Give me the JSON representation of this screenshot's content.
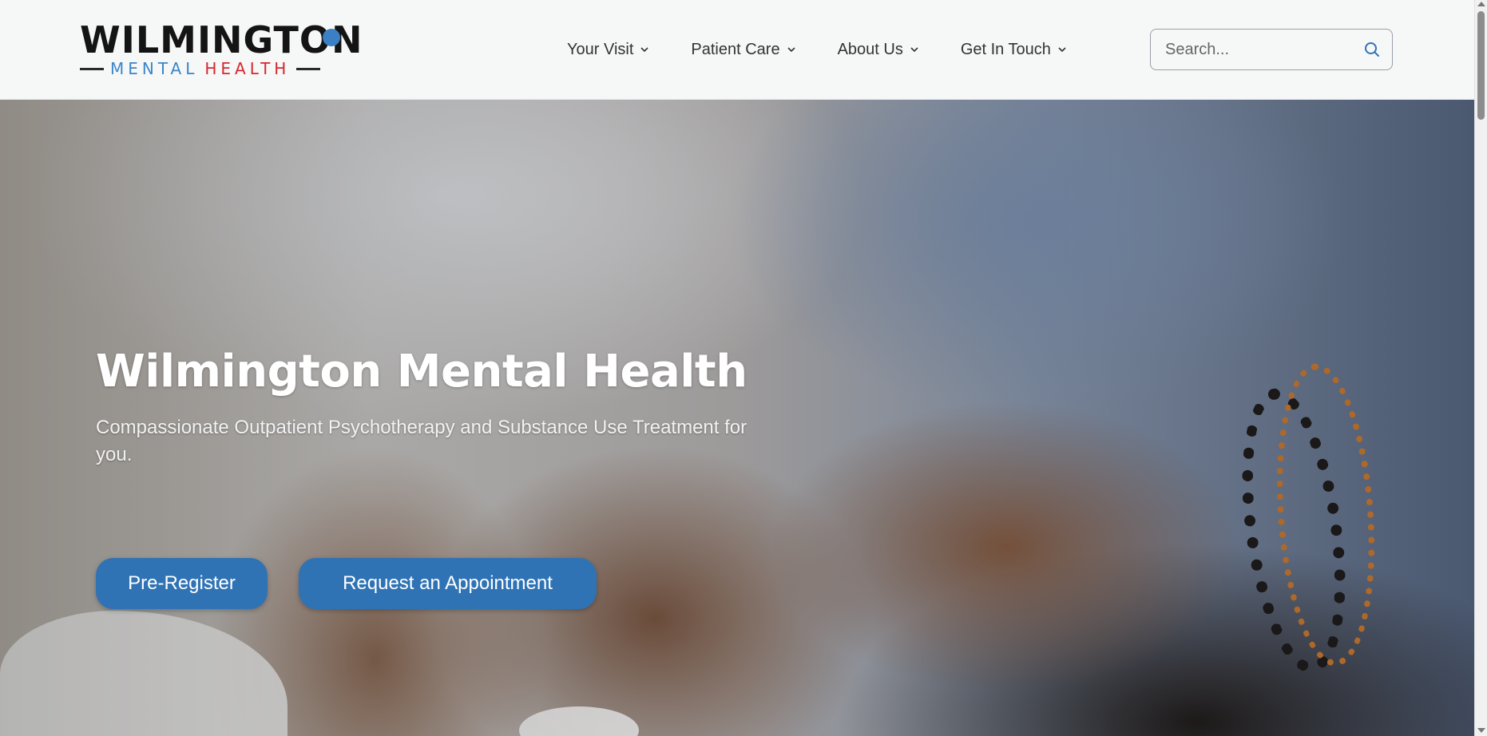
{
  "header": {
    "logo": {
      "main": "WILMINGTON",
      "sub_part1": "MENTAL",
      "sub_part2": "HEALTH"
    },
    "nav": [
      {
        "label": "Your Visit",
        "icon": "chevron-down-icon"
      },
      {
        "label": "Patient Care",
        "icon": "chevron-down-icon"
      },
      {
        "label": "About Us",
        "icon": "chevron-down-icon"
      },
      {
        "label": "Get In Touch",
        "icon": "chevron-down-icon"
      }
    ],
    "search": {
      "placeholder": "Search...",
      "value": "",
      "icon": "search-icon"
    }
  },
  "hero": {
    "title": "Wilmington Mental Health",
    "subtitle": "Compassionate Outpatient Psychotherapy and Substance Use Treatment for you.",
    "buttons": {
      "pre_register": "Pre-Register",
      "request_appointment": "Request an Appointment"
    },
    "background": "photo of clasped hands"
  },
  "colors": {
    "brand_blue": "#2f73b5",
    "logo_blue": "#3b86c9",
    "logo_red": "#d7262e",
    "text_dark": "#141414"
  }
}
